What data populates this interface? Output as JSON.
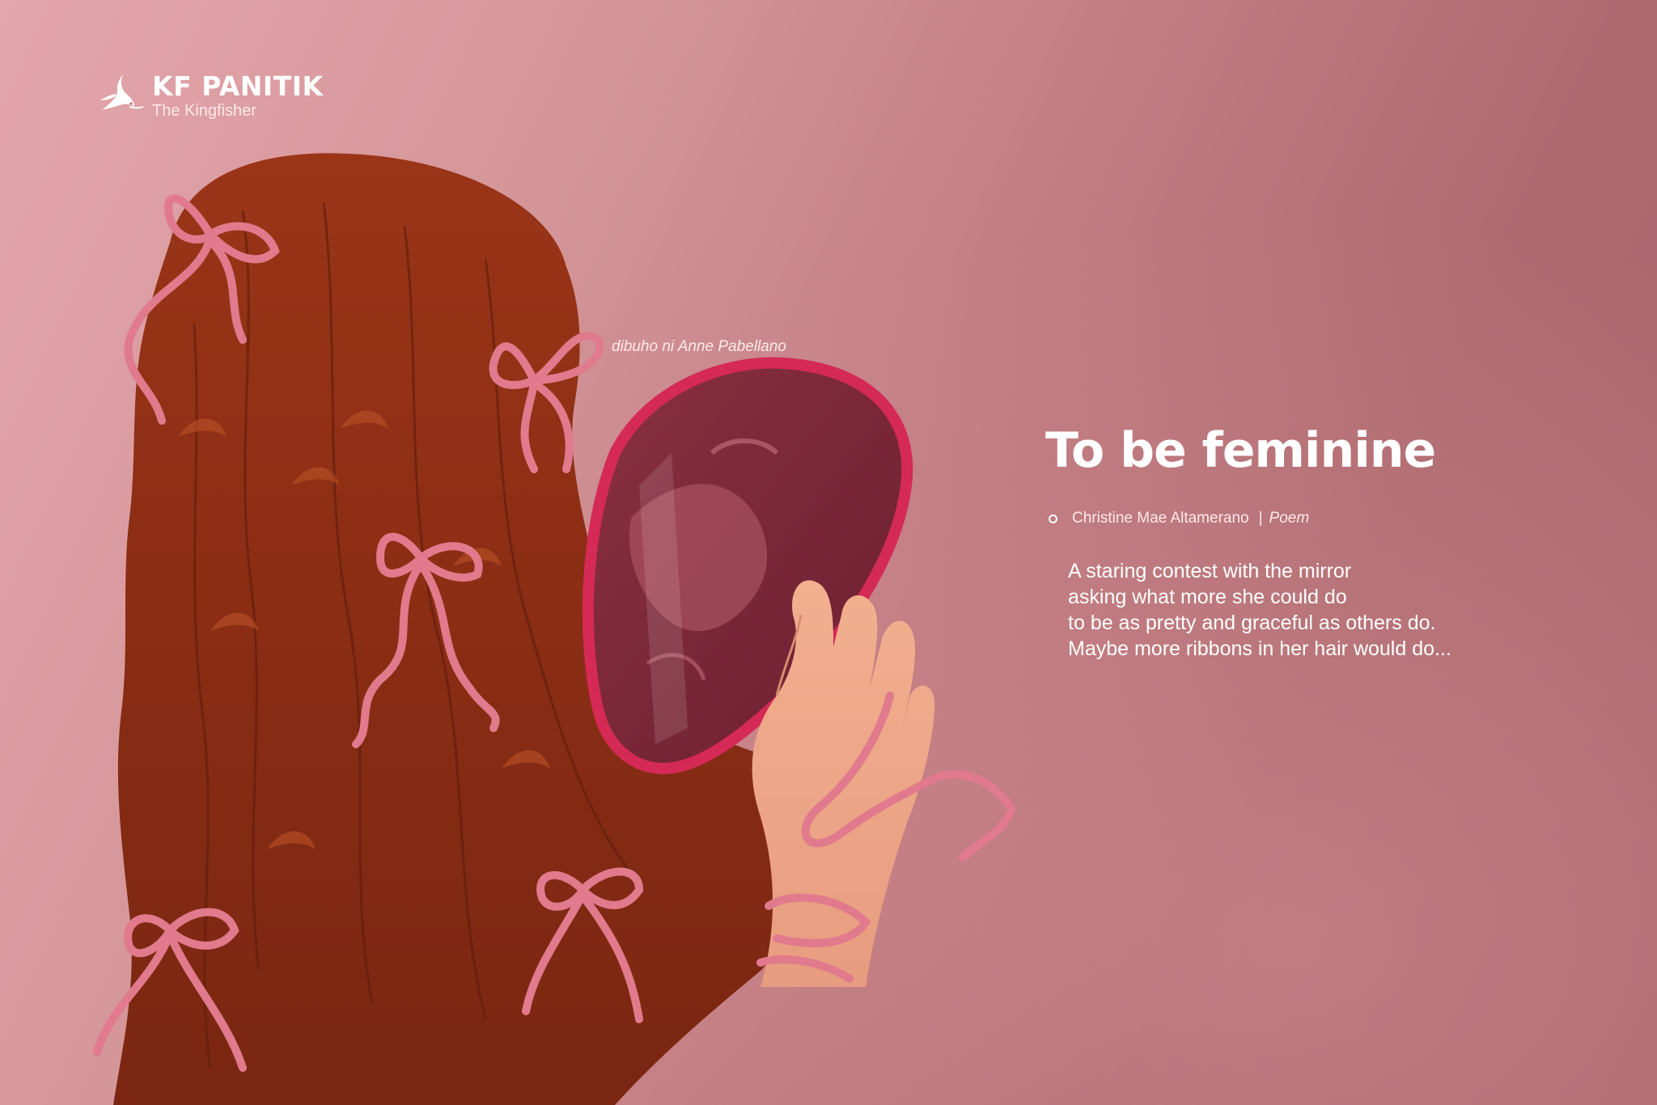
{
  "brand": {
    "name": "KF PANITIK",
    "subtitle": "The Kingfisher",
    "logo_icon": "kingfisher-bird-icon"
  },
  "illustration": {
    "credit": "dibuho ni Anne Pabellano",
    "subject": "woman-with-ribbons-looking-in-hand-mirror"
  },
  "article": {
    "title": "To be feminine",
    "author": "Christine Mae Altamerano",
    "separator": "|",
    "category": "Poem",
    "bullet_icon": "ring-bullet-icon",
    "excerpt": [
      "A staring contest with the mirror",
      "asking what more she could do",
      "to be as pretty and graceful as others do.",
      "Maybe more ribbons in her hair would do..."
    ]
  },
  "colors": {
    "background_light": "#e3a6ab",
    "background_dark": "#a66469",
    "hair": "#8a2f16",
    "ribbon": "#e07a8c",
    "mirror_frame": "#d42a55",
    "text": "#ffffff"
  }
}
